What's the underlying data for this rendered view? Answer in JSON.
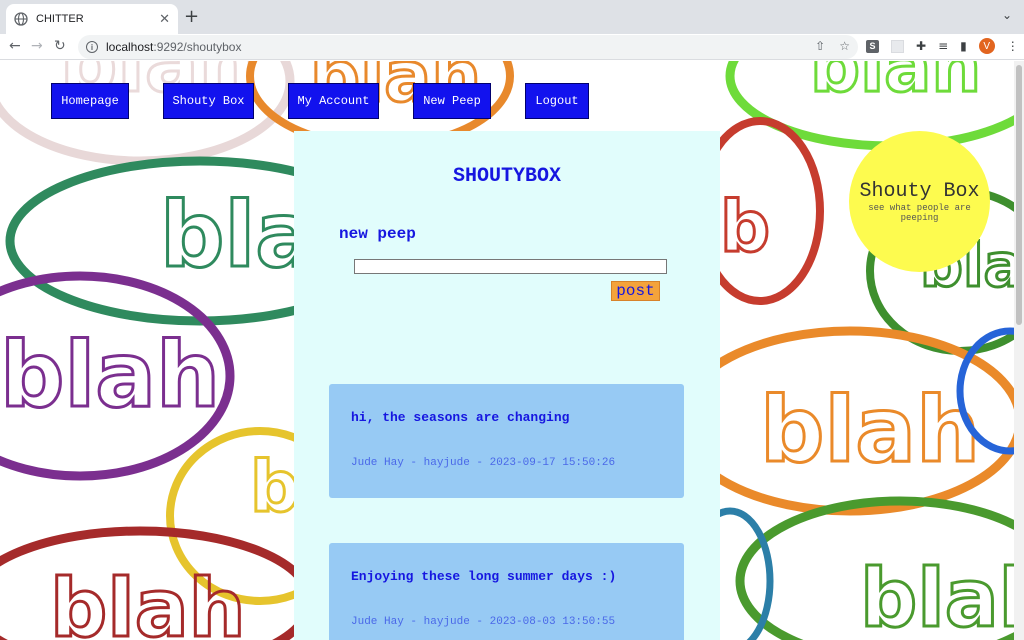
{
  "browser": {
    "tab_title": "CHITTER",
    "url_host": "localhost",
    "url_port_path": ":9292/shoutybox",
    "avatar_letter": "V"
  },
  "nav": {
    "homepage": "Homepage",
    "shouty_box": "Shouty Box",
    "my_account": "My Account",
    "new_peep": "New Peep",
    "logout": "Logout"
  },
  "main": {
    "heading": "SHOUTYBOX",
    "new_peep_heading": "new peep",
    "input_value": "",
    "post_label": "post"
  },
  "peeps": [
    {
      "text": "hi, the seasons are changing",
      "meta": "Jude Hay - hayjude - 2023-09-17 15:50:26"
    },
    {
      "text": "Enjoying these long summer days :)",
      "meta": "Jude Hay - hayjude - 2023-08-03 13:50:55"
    }
  ],
  "logo": {
    "title": "Shouty Box",
    "tagline": "see what people are peeping"
  },
  "background": {
    "word": "blah",
    "word_cut": "bla",
    "word_b": "b"
  },
  "colors": {
    "nav_bg": "#1212ee",
    "panel_bg": "#e1fdfc",
    "card_bg": "#97caf4",
    "accent_text": "#1616e0",
    "post_bg": "#f4a33b",
    "logo_bg": "#fdfb4f"
  }
}
